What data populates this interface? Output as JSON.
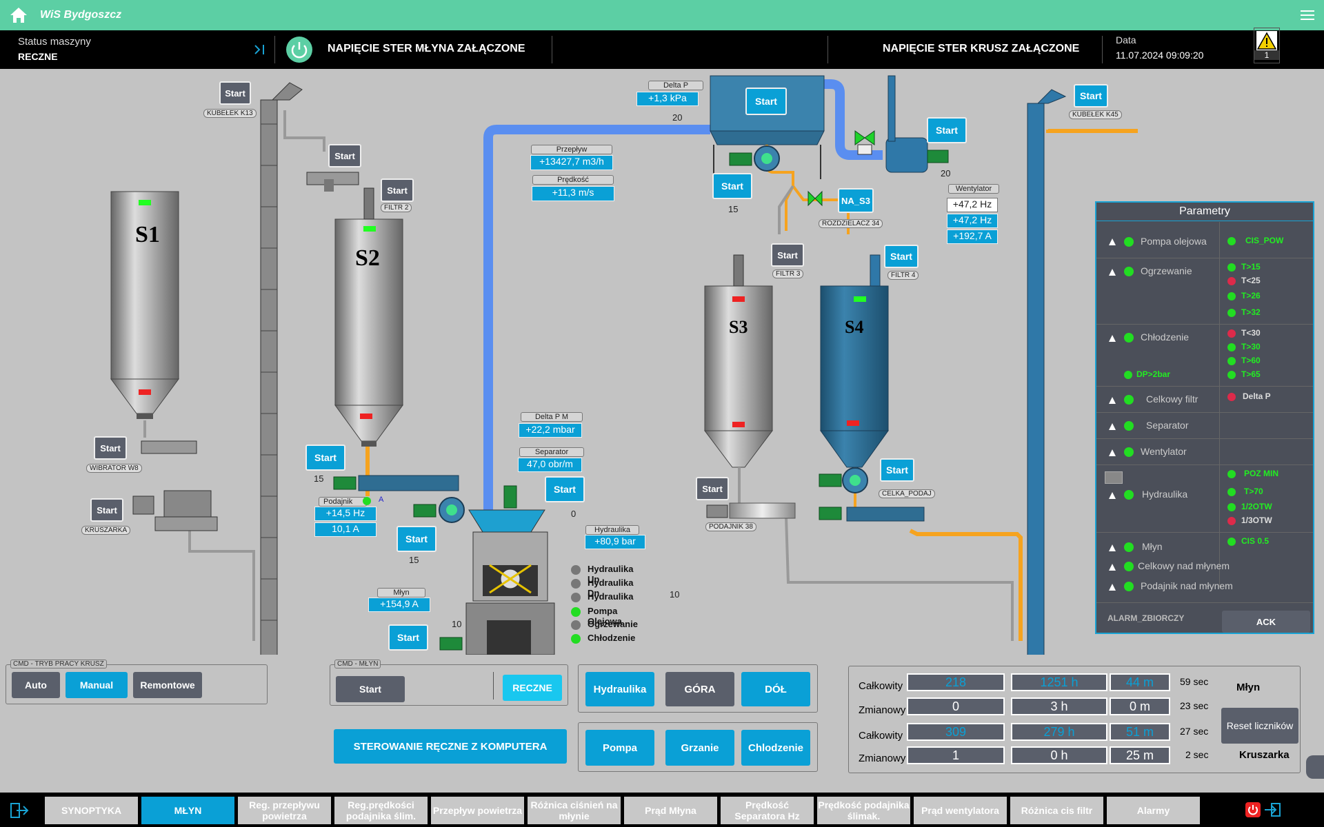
{
  "app": {
    "title": "WiS Bydgoszcz"
  },
  "status": {
    "label": "Status maszyny",
    "value": "RECZNE",
    "msg_mill": "NAPIĘCIE STER MŁYNA ZAŁĄCZONE",
    "msg_crusher": "NAPIĘCIE STER KRUSZ ZAŁĄCZONE",
    "date_label": "Data",
    "date_value": "11.07.2024 09:09:20",
    "alarm_count": "1"
  },
  "silos": {
    "s1": "S1",
    "s2": "S2",
    "s3": "S3",
    "s4": "S4"
  },
  "start": "Start",
  "tags": {
    "k13": "KUBEŁEK K13",
    "k45": "KUBEŁEK K45",
    "filtr2": "FILTR 2",
    "filtr3": "FILTR 3",
    "filtr4": "FILTR 4",
    "wib": "WIBRATOR W8",
    "krusz": "KRUSZARKA",
    "rozdz": "ROZDZIELACZ 34",
    "celka": "CELKA_PODAJ",
    "pod38": "PODAJNIK 38"
  },
  "measures": {
    "delta_p_label": "Delta P",
    "delta_p": "+1,3 kPa",
    "przeplyw_label": "Przepływ",
    "przeplyw": "+13427,7 m3/h",
    "predkosc_label": "Prędkość",
    "predkosc": "+11,3 m/s",
    "went_label": "Wentylator",
    "went_hz1": "+47,2 Hz",
    "went_hz2": "+47,2 Hz",
    "went_a": "+192,7 A",
    "dpm_label": "Delta P M",
    "dpm": "+22,2 mbar",
    "sep_label": "Separator",
    "sep": "47,0 obr/m",
    "hyd_label": "Hydraulika",
    "hyd": "+80,9 bar",
    "mlyn_label": "Młyn",
    "mlyn": "+154,9 A",
    "pod_label": "Podajnik",
    "pod_a_mark": "A",
    "pod_hz": "+14,5 Hz",
    "pod_a": "10,1 A",
    "na_s3": "NA_S3",
    "n20a": "20",
    "n20b": "20",
    "n15a": "15",
    "n15b": "15",
    "n15c": "15",
    "n0": "0",
    "n10a": "10",
    "n10b": "10"
  },
  "hyd_indicators": [
    "Hydraulika Up",
    "Hydraulika Dn",
    "Hydraulika",
    "Pompa Olejowa",
    "Ogrzewanie",
    "Chłodzenie"
  ],
  "params": {
    "title": "Parametry",
    "rows": [
      "Pompa olejowa",
      "Ogrzewanie",
      "Chłodzenie",
      "Celkowy filtr",
      "Separator",
      "Wentylator",
      "Hydraulika",
      "Młyn",
      "Celkowy nad młynem",
      "Podajnik nad młynem"
    ],
    "cis_pow": "CIS_POW",
    "ogrz": [
      "T>15",
      "T<25",
      "T>26",
      "T>32"
    ],
    "chlod": [
      "T<30",
      "T>30",
      "T>60",
      "T>65"
    ],
    "dp2bar": "DP>2bar",
    "delta_p": "Delta P",
    "hyd": [
      "POZ MIN",
      "T>70",
      "1/2OTW",
      "1/3OTW"
    ],
    "cis05": "CIS 0.5",
    "alarm": "ALARM_ZBIORCZY",
    "ack": "ACK"
  },
  "cmd_krusz": {
    "legend": "CMD - TRYB PRACY KRUSZ",
    "auto": "Auto",
    "manual": "Manual",
    "remont": "Remontowe"
  },
  "cmd_mlyn": {
    "legend": "CMD - MŁYN",
    "start": "Start",
    "reczne": "RECZNE"
  },
  "manual_pc": "STEROWANIE RĘCZNE Z KOMPUTERA",
  "hyd_buttons": {
    "hydraulika": "Hydraulika",
    "gora": "GÓRA",
    "dol": "DÓŁ",
    "pompa": "Pompa",
    "grzanie": "Grzanie",
    "chlodzenie": "Chlodzenie"
  },
  "counters": {
    "calk": "Całkowity",
    "zmian": "Zmianowy",
    "r1": [
      "218",
      "1251 h",
      "44 m",
      "59 sec"
    ],
    "r2": [
      "0",
      "3 h",
      "0 m",
      "23 sec"
    ],
    "r3": [
      "309",
      "279 h",
      "51 m",
      "27 sec"
    ],
    "r4": [
      "1",
      "0 h",
      "25 m",
      "2 sec"
    ],
    "mlyn": "Młyn",
    "reset": "Reset liczników",
    "kruszarka": "Kruszarka"
  },
  "nav": [
    "SYNOPTYKA",
    "MŁYN",
    "Reg. przepływu powietrza",
    "Reg.prędkości podajnika ślim.",
    "Przepływ powietrza",
    "Różnica ciśnień na młynie",
    "Prąd Młyna",
    "Prędkość Separatora Hz",
    "Prędkość podajnika ślimak.",
    "Prąd wentylatora",
    "Różnica cis filtr",
    "Alarmy"
  ],
  "colors": {
    "accent": "#0aa0d6",
    "topbar": "#5ccfa4",
    "panel": "#4b4f59",
    "ok": "#22dd22",
    "alarm": "#dd2a4a"
  }
}
